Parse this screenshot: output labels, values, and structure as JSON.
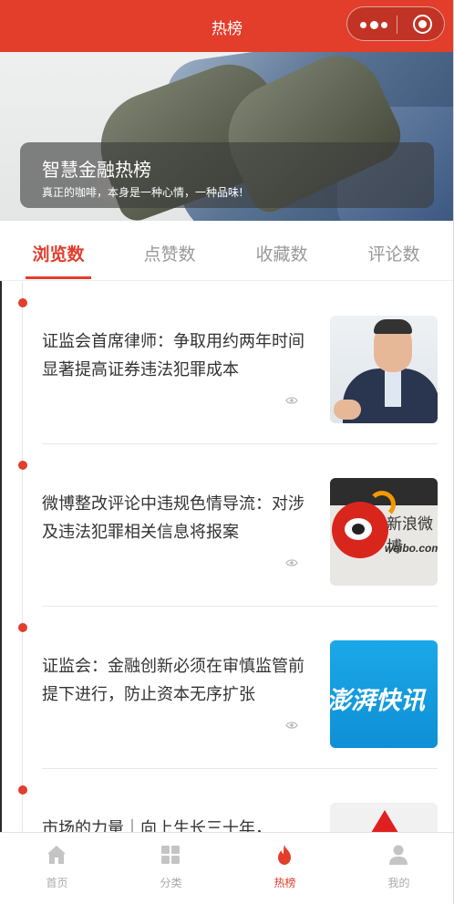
{
  "header": {
    "title": "热榜"
  },
  "banner": {
    "title": "智慧金融热榜",
    "subtitle": "真正的咖啡，本身是一种心情，一种品味!"
  },
  "tabs": [
    {
      "label": "浏览数",
      "active": true
    },
    {
      "label": "点赞数",
      "active": false
    },
    {
      "label": "收藏数",
      "active": false
    },
    {
      "label": "评论数",
      "active": false
    }
  ],
  "feed": [
    {
      "title": "证监会首席律师：争取用约两年时间显著提高证券违法犯罪成本",
      "thumbnail": "man-in-suit-photo"
    },
    {
      "title": "微博整改评论中违规色情导流：对涉及违法犯罪相关信息将报案",
      "thumbnail": "weibo-logo-photo",
      "thumb_text_1": "新浪微博",
      "thumb_text_2": "weibo.com"
    },
    {
      "title": "证监会：金融创新必须在审慎监管前提下进行，防止资本无序扩张",
      "thumbnail": "pengpai-news-graphic",
      "thumb_text": "澎湃快讯"
    },
    {
      "title": "市场的力量｜向上生长三十年，",
      "thumbnail": "red-logo-image"
    }
  ],
  "bottom_nav": [
    {
      "label": "首页",
      "icon": "home-icon",
      "active": false
    },
    {
      "label": "分类",
      "icon": "grid-icon",
      "active": false
    },
    {
      "label": "热榜",
      "icon": "flame-icon",
      "active": true
    },
    {
      "label": "我的",
      "icon": "user-icon",
      "active": false
    }
  ],
  "colors": {
    "accent": "#e33d2b",
    "inactive": "#aaaaaa",
    "text": "#333333"
  }
}
